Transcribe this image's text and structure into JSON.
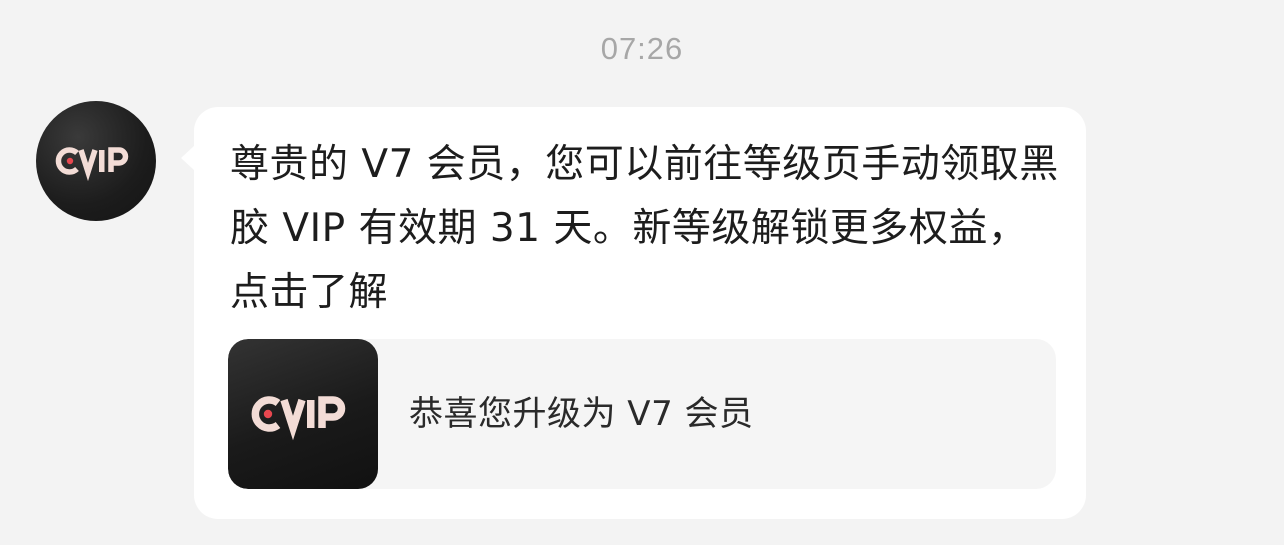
{
  "timestamp": "07:26",
  "sender": {
    "avatar_logo": "CVIP",
    "avatar_icon": "vinyl-vip-logo-icon"
  },
  "message": {
    "text": "尊贵的 V7 会员，您可以前往等级页手动领取黑胶 VIP 有效期 31 天。新等级解锁更多权益，点击了解",
    "card": {
      "logo": "CVIP",
      "logo_icon": "vinyl-vip-logo-icon",
      "title": "恭喜您升级为 V7 会员"
    }
  },
  "colors": {
    "background": "#f3f3f3",
    "bubble": "#ffffff",
    "card": "#f5f5f5",
    "logo_dark": "#1c1c1c",
    "logo_letters": "#f3dcd6",
    "logo_dot": "#e8474f"
  }
}
